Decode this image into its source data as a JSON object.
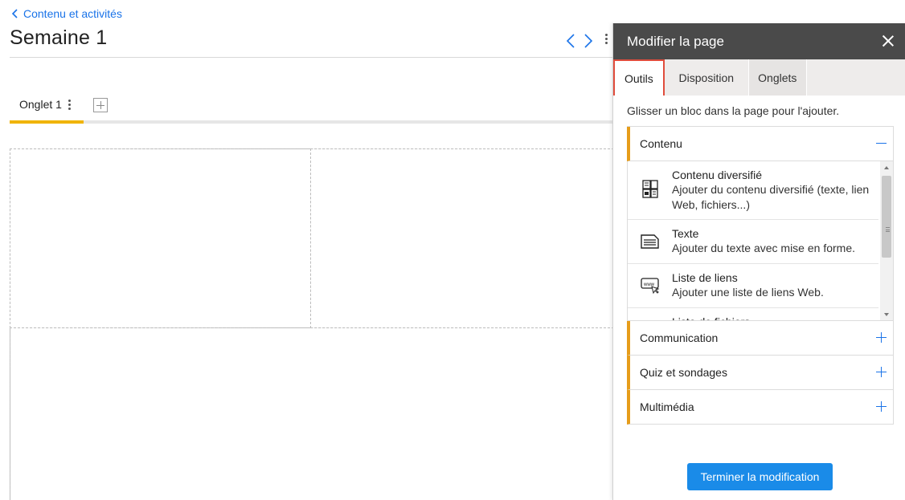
{
  "header": {
    "back_link": "Contenu et activités",
    "page_title": "Semaine 1"
  },
  "tabs": {
    "active_label": "Onglet 1"
  },
  "panel": {
    "title": "Modifier la page",
    "tabs": [
      {
        "label": "Outils",
        "active": true
      },
      {
        "label": "Disposition",
        "active": false
      },
      {
        "label": "Onglets",
        "active": false
      }
    ],
    "hint": "Glisser un bloc dans la page pour l'ajouter.",
    "sections": [
      {
        "label": "Contenu",
        "expanded": true,
        "items": [
          {
            "name": "Contenu diversifié",
            "desc": "Ajouter du contenu diversifié (texte, lien Web, fichiers...)",
            "icon": "mixed-content-icon"
          },
          {
            "name": "Texte",
            "desc": "Ajouter du texte avec mise en forme.",
            "icon": "text-icon"
          },
          {
            "name": "Liste de liens",
            "desc": "Ajouter une liste de liens Web.",
            "icon": "web-links-icon"
          },
          {
            "name": "Liste de fichiers",
            "desc": "",
            "icon": "file-list-icon"
          }
        ]
      },
      {
        "label": "Communication",
        "expanded": false
      },
      {
        "label": "Quiz et sondages",
        "expanded": false
      },
      {
        "label": "Multimédia",
        "expanded": false
      }
    ],
    "finish_button": "Terminer la modification"
  },
  "colors": {
    "accent_blue": "#1a73e8",
    "tab_underline": "#f0b400",
    "section_bar": "#e69d1a",
    "header_bg": "#4a4a4a",
    "active_tab_outline": "#e04c3c",
    "button_bg": "#1a8be8"
  }
}
